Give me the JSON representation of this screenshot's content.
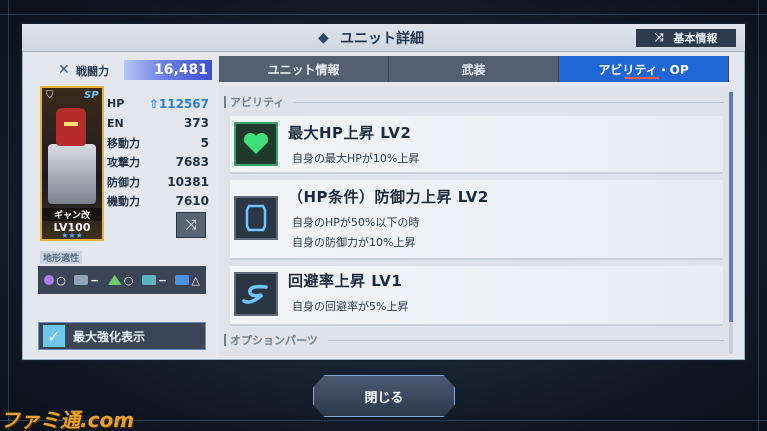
{
  "header": {
    "title": "ユニット詳細",
    "basic_info_label": "基本情報"
  },
  "unit": {
    "power_label": "戦闘力",
    "power_value": "16,481",
    "sp_badge": "SP",
    "name": "ギャン改",
    "level": "LV100",
    "stars": "★★★",
    "stats": [
      {
        "label": "HP",
        "value": "112567",
        "boosted": true
      },
      {
        "label": "EN",
        "value": "373"
      },
      {
        "label": "移動力",
        "value": "5"
      },
      {
        "label": "攻撃力",
        "value": "7683"
      },
      {
        "label": "防御力",
        "value": "10381"
      },
      {
        "label": "機動力",
        "value": "7610"
      }
    ]
  },
  "terrain": {
    "label": "地形適性",
    "items": [
      {
        "icon": "space-icon",
        "rank": "○",
        "color": "#b07cf0"
      },
      {
        "icon": "air-icon",
        "rank": "−",
        "color": "#8fa3b8"
      },
      {
        "icon": "ground-icon",
        "rank": "○",
        "color": "#6ad06a"
      },
      {
        "icon": "water-icon",
        "rank": "−",
        "color": "#5ab4c8"
      },
      {
        "icon": "underwater-icon",
        "rank": "△",
        "color": "#4a8fe0"
      }
    ]
  },
  "max_toggle": {
    "label": "最大強化表示",
    "checked": true
  },
  "tabs": [
    {
      "label": "ユニット情報",
      "active": false
    },
    {
      "label": "武装",
      "active": false
    },
    {
      "label": "アビリティ・OP",
      "active": true
    }
  ],
  "abilities_section": "アビリティ",
  "abilities": [
    {
      "icon": "heart-icon",
      "title": "最大HP上昇 LV2",
      "desc": [
        "自身の最大HPが10%上昇"
      ]
    },
    {
      "icon": "shield-icon",
      "title": "（HP条件）防御力上昇 LV2",
      "desc": [
        "自身のHPが50%以下の時",
        "自身の防御力が10%上昇"
      ]
    },
    {
      "icon": "evasion-icon",
      "title": "回避率上昇 LV1",
      "desc": [
        "自身の回避率が5%上昇"
      ]
    }
  ],
  "options_section": "オプションパーツ",
  "close_label": "閉じる",
  "watermark": "ファミ通.com"
}
